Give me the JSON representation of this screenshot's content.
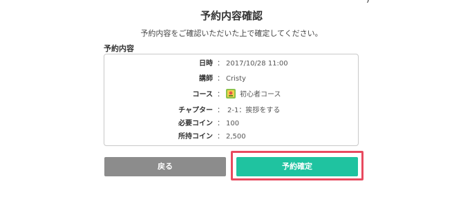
{
  "header": {
    "close_glyph": ")",
    "title": "予約内容確認",
    "subtitle": "予約内容をご確認いただいた上で確定してください。"
  },
  "details": {
    "section_label": "予約内容",
    "rows": [
      {
        "label": "日時",
        "value": "2017/10/28 11:00"
      },
      {
        "label": "講師",
        "value": "Cristy"
      },
      {
        "label": "コース",
        "value": "初心者コース",
        "icon": "course-badge-icon"
      },
      {
        "label": "チャプター",
        "value": "2-1：挨拶をする"
      },
      {
        "label": "必要コイン",
        "value": "100"
      },
      {
        "label": "所持コイン",
        "value": "2,500"
      }
    ],
    "colon": "："
  },
  "actions": {
    "back_label": "戻る",
    "confirm_label": "予約確定"
  },
  "colors": {
    "back_button": "#8c8c8c",
    "confirm_button": "#1fc3a0",
    "highlight_frame": "#e84a5f",
    "footnote": "#e03b3b"
  }
}
